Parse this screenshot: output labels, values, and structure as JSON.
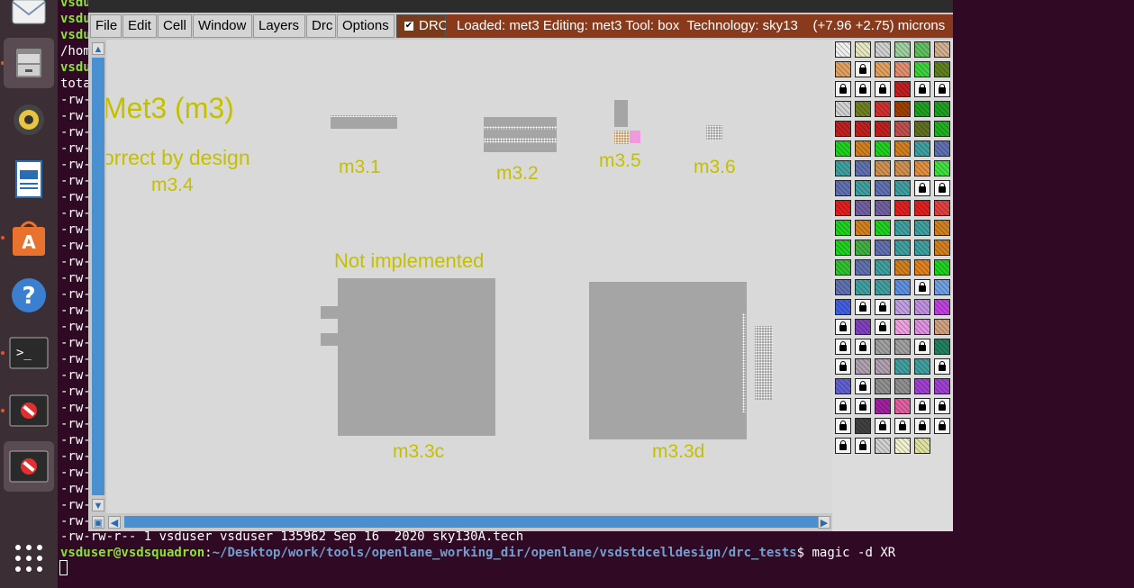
{
  "terminal": {
    "lines": [
      {
        "text": "vsdu",
        "bold": true
      },
      {
        "text": "vsdu",
        "bold": true
      },
      {
        "text": "vsdu",
        "bold": true
      },
      {
        "text": "/hom",
        "bold": false
      },
      {
        "text": "vsdu",
        "bold": true
      },
      {
        "text": "tota",
        "bold": false
      },
      {
        "text": "-rw-",
        "bold": false
      },
      {
        "text": "-rw-",
        "bold": false
      },
      {
        "text": "-rw-",
        "bold": false
      },
      {
        "text": "-rw-",
        "bold": false
      },
      {
        "text": "-rw-",
        "bold": false
      },
      {
        "text": "-rw-",
        "bold": false
      },
      {
        "text": "-rw-",
        "bold": false
      },
      {
        "text": "-rw-",
        "bold": false
      },
      {
        "text": "-rw-",
        "bold": false
      },
      {
        "text": "-rw-",
        "bold": false
      },
      {
        "text": "-rw-",
        "bold": false
      },
      {
        "text": "-rw-",
        "bold": false
      },
      {
        "text": "-rw-",
        "bold": false
      },
      {
        "text": "-rw-",
        "bold": false
      },
      {
        "text": "-rw-",
        "bold": false
      },
      {
        "text": "-rw-",
        "bold": false
      },
      {
        "text": "-rw-",
        "bold": false
      },
      {
        "text": "-rw-",
        "bold": false
      },
      {
        "text": "-rw-",
        "bold": false
      },
      {
        "text": "-rw-",
        "bold": false
      },
      {
        "text": "-rw-",
        "bold": false
      },
      {
        "text": "-rw-",
        "bold": false
      },
      {
        "text": "-rw-",
        "bold": false
      },
      {
        "text": "-rw-",
        "bold": false
      },
      {
        "text": "-rw-",
        "bold": false
      },
      {
        "text": "-rw-",
        "bold": false
      },
      {
        "text": "-rw-",
        "bold": false
      }
    ],
    "file_line": "-rw-rw-r-- 1 vsduser vsduser 135962 Sep 16  2020 sky130A.tech",
    "prompt_user": "vsduser@vsdsquadron",
    "prompt_colon": ":",
    "prompt_path": "~/Desktop/work/tools/openlane_working_dir/openlane/vsdstdcelldesign/drc_tests",
    "prompt_cmd": "$ magic -d XR"
  },
  "dock": {
    "items": [
      "mail-icon",
      "file-manager-icon",
      "speaker-icon",
      "writer-icon",
      "software-center-icon",
      "help-icon",
      "terminal-icon",
      "blocked-app-icon",
      "blocked-app-icon",
      "apps-grid-icon"
    ]
  },
  "magic": {
    "menu": [
      "File",
      "Edit",
      "Cell",
      "Window",
      "Layers",
      "Drc",
      "Options"
    ],
    "drc_label": "DRC",
    "drc_checked": true,
    "status": "Loaded: met3 Editing: met3 Tool: box  Technology: sky13    (+7.96 +2.75) microns",
    "canvas": {
      "title": "Met3 (m3)",
      "correct": "orrect by design",
      "labels": {
        "m34": "m3.4",
        "m31": "m3.1",
        "m32": "m3.2",
        "m35": "m3.5",
        "m36": "m3.6",
        "not_impl": "Not implemented",
        "m33c": "m3.3c",
        "m33d": "m3.3d"
      }
    }
  },
  "colors": {
    "terminal_bg": "#300a24",
    "prompt_green": "#8ae234",
    "prompt_blue": "#729fcf",
    "label_yellow": "#c4c000",
    "layer_gray": "#a5a5a5",
    "scroll_blue": "#4a90d0",
    "status_bg": "#8a3a1c"
  }
}
